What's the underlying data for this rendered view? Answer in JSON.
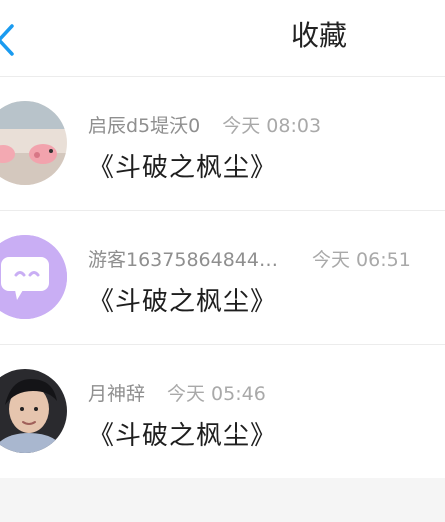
{
  "header": {
    "title": "收藏"
  },
  "items": [
    {
      "name": "启辰d5堤沃0",
      "time": "今天 08:03",
      "book": "《斗破之枫尘》",
      "avatar": "pig-avatar"
    },
    {
      "name": "游客16375864844…",
      "time": "今天 06:51",
      "book": "《斗破之枫尘》",
      "avatar": "chat-bubble-avatar"
    },
    {
      "name": "月神辞",
      "time": "今天 05:46",
      "book": "《斗破之枫尘》",
      "avatar": "portrait-avatar"
    }
  ],
  "colors": {
    "accent": "#1a9bf0",
    "avatar_purple": "#c9aef4"
  }
}
